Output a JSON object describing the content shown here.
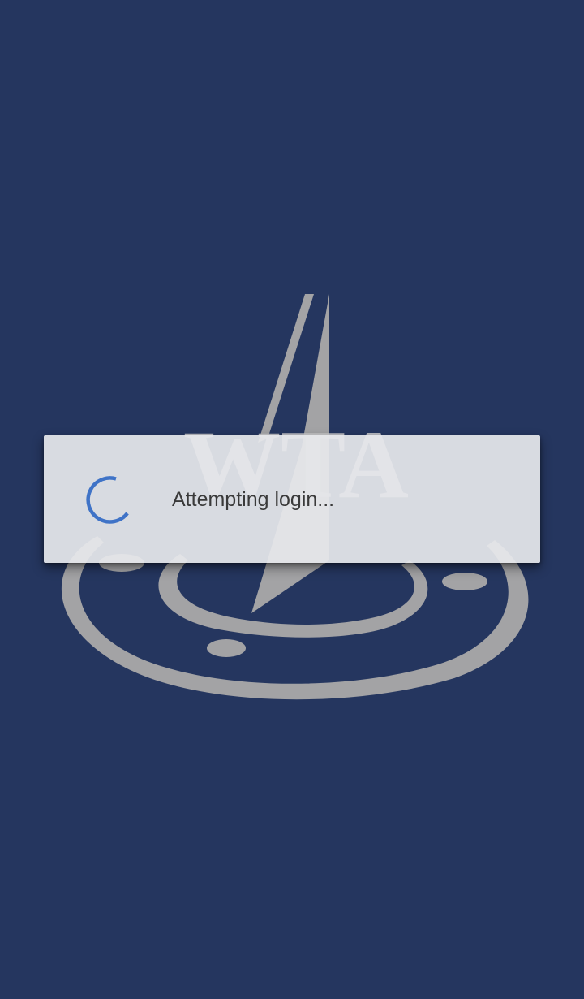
{
  "colors": {
    "background": "#25365f",
    "logo": "#a3a3a5",
    "spinner": "#3f73c7",
    "dialog_bg": "#e6e7eb",
    "message_text": "#3a3a3a"
  },
  "background_logo": {
    "icon": "wta-compass-logo",
    "text": "WTA"
  },
  "dialog": {
    "spinner_icon": "progress-spinner-icon",
    "message": "Attempting login..."
  }
}
